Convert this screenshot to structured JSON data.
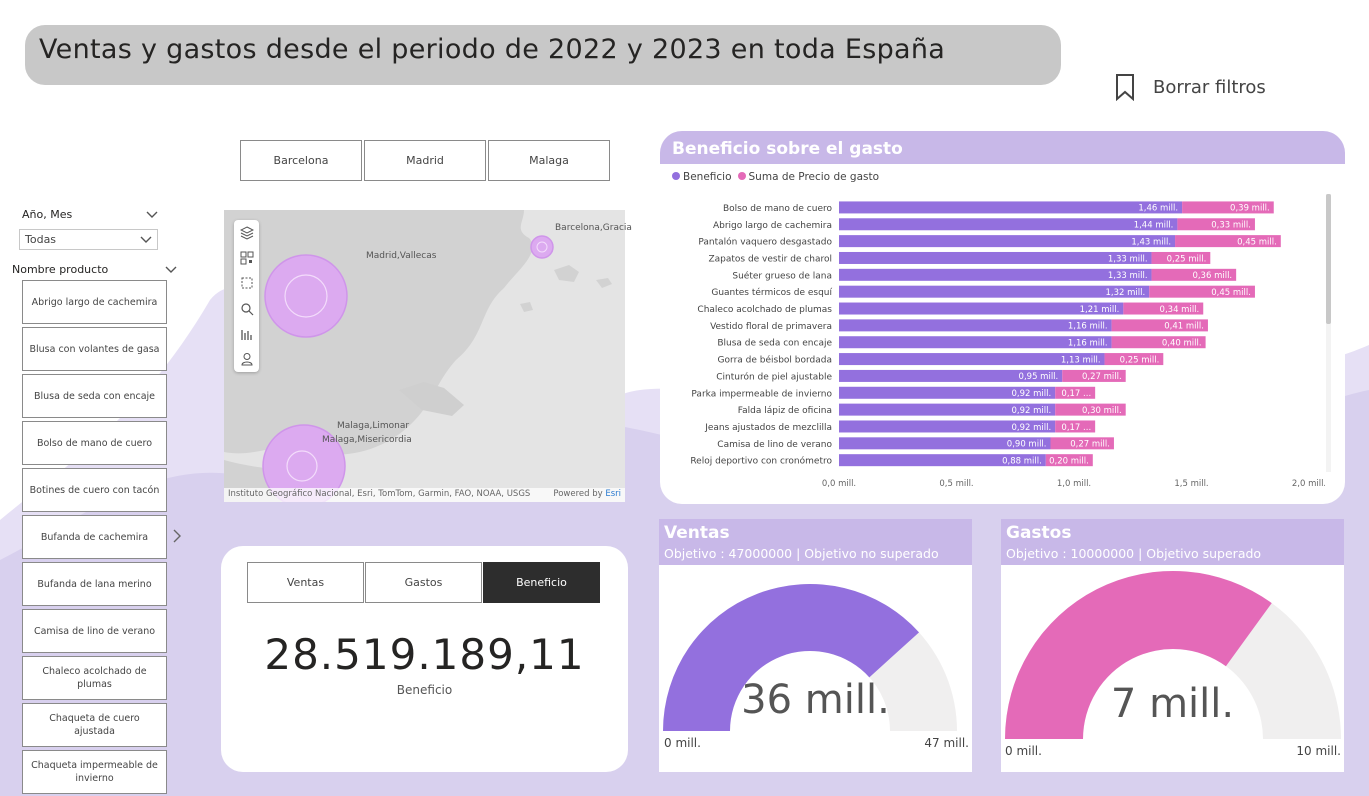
{
  "header": {
    "title": "Ventas y gastos desde el periodo de 2022 y 2023 en toda España"
  },
  "clear_filters": {
    "label": "Borrar filtros",
    "icon": "bookmark-icon"
  },
  "city_slicer": {
    "options": [
      "Barcelona",
      "Madrid",
      "Malaga"
    ]
  },
  "date_slicer": {
    "header": "Año, Mes",
    "value": "Todas"
  },
  "product_slicer": {
    "header": "Nombre producto",
    "items": [
      "Abrigo largo de cachemira",
      "Blusa con volantes de gasa",
      "Blusa de seda con encaje",
      "Bolso de mano de cuero",
      "Botines de cuero con tacón",
      "Bufanda de cachemira",
      "Bufanda de lana merino",
      "Camisa de lino de verano",
      "Chaleco acolchado de plumas",
      "Chaqueta de cuero ajustada",
      "Chaqueta impermeable de invierno"
    ]
  },
  "map": {
    "labels": [
      "Barcelona,Gracia",
      "Madrid,Vallecas",
      "Malaga,Limonar",
      "Malaga,Misericordia"
    ],
    "attribution": "Instituto Geográfico Nacional, Esri, TomTom, Garmin, FAO, NOAA, USGS",
    "powered_prefix": "Powered by",
    "powered_brand": "Esri",
    "tools": [
      "layers-icon",
      "qr-icon",
      "select-rect-icon",
      "search-icon",
      "bars-icon",
      "person-icon"
    ]
  },
  "kpi": {
    "tabs": [
      "Ventas",
      "Gastos",
      "Beneficio"
    ],
    "active_tab": "Beneficio",
    "value": "28.519.189,11",
    "label": "Beneficio"
  },
  "chart_data": [
    {
      "type": "bar",
      "orientation": "horizontal",
      "stacked": true,
      "title": "Beneficio sobre el gasto",
      "categories": [
        "Bolso de mano de cuero",
        "Abrigo largo de cachemira",
        "Pantalón vaquero desgastado",
        "Zapatos de vestir de charol",
        "Suéter grueso de lana",
        "Guantes térmicos de esquí",
        "Chaleco acolchado de plumas",
        "Vestido floral de primavera",
        "Blusa de seda con encaje",
        "Gorra de béisbol bordada",
        "Cinturón de piel ajustable",
        "Parka impermeable de invierno",
        "Falda lápiz de oficina",
        "Jeans ajustados de mezclilla",
        "Camisa de lino de verano",
        "Reloj deportivo con cronómetro"
      ],
      "series": [
        {
          "name": "Beneficio",
          "color": "#9370de",
          "values": [
            1.46,
            1.44,
            1.43,
            1.33,
            1.33,
            1.32,
            1.21,
            1.16,
            1.16,
            1.13,
            0.95,
            0.92,
            0.92,
            0.92,
            0.9,
            0.88
          ],
          "labels": [
            "1,46 mill.",
            "1,44 mill.",
            "1,43 mill.",
            "1,33 mill.",
            "1,33 mill.",
            "1,32 mill.",
            "1,21 mill.",
            "1,16 mill.",
            "1,16 mill.",
            "1,13 mill.",
            "0,95 mill.",
            "0,92 mill.",
            "0,92 mill.",
            "0,92 mill.",
            "0,90 mill.",
            "0,88 mill."
          ]
        },
        {
          "name": "Suma de Precio de gasto",
          "color": "#e46ab8",
          "values": [
            0.39,
            0.33,
            0.45,
            0.25,
            0.36,
            0.45,
            0.34,
            0.41,
            0.4,
            0.25,
            0.27,
            0.17,
            0.3,
            0.17,
            0.27,
            0.2
          ],
          "labels": [
            "0,39 mill.",
            "0,33 mill.",
            "0,45 mill.",
            "0,25 mill.",
            "0,36 mill.",
            "0,45 mill.",
            "0,34 mill.",
            "0,41 mill.",
            "0,40 mill.",
            "0,25 mill.",
            "0,27 mill.",
            "0,17 ...",
            "0,30 mill.",
            "0,17 ...",
            "0,27 mill.",
            "0,20 mill."
          ]
        }
      ],
      "xlim": [
        0,
        2.0
      ],
      "xticks": [
        "0,0 mill.",
        "0,5 mill.",
        "1,0 mill.",
        "1,5 mill.",
        "2,0 mill."
      ],
      "legend": "top-left"
    },
    {
      "type": "gauge",
      "title": "Ventas",
      "subtitle": "Objetivo : 47000000 | Objetivo no superado",
      "value": 36,
      "min": 0,
      "max": 47,
      "value_label": "36 mill.",
      "min_label": "0 mill.",
      "max_label": "47 mill.",
      "color": "#9370de"
    },
    {
      "type": "gauge",
      "title": "Gastos",
      "subtitle": "Objetivo : 10000000 | Objetivo superado",
      "value": 7,
      "min": 0,
      "max": 10,
      "value_label": "7 mill.",
      "min_label": "0 mill.",
      "max_label": "10 mill.",
      "color": "#e46ab8"
    }
  ],
  "colors": {
    "accent_purple": "#9370de",
    "accent_pink": "#e46ab8",
    "header_lilac": "#c8b8e8",
    "wave": "#d8d0ee"
  }
}
